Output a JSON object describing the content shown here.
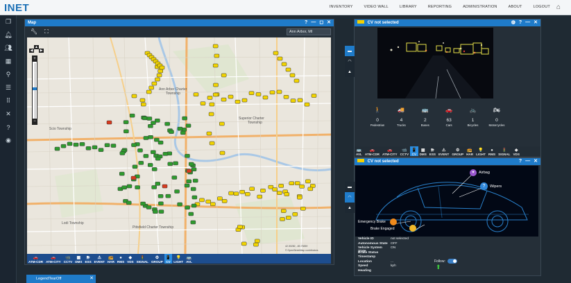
{
  "app": {
    "logo": "INET"
  },
  "topnav": [
    "INVENTORY",
    "VIDEO WALL",
    "LIBRARY",
    "REPORTING",
    "ADMINISTRATION",
    "ABOUT",
    "LOGOUT"
  ],
  "sidebar_icons": [
    "copy-icon",
    "bell-icon",
    "users-icon",
    "grid-icon",
    "filter-icon",
    "list-icon",
    "apps-icon",
    "tools-icon",
    "help-icon",
    "user-icon"
  ],
  "map_panel": {
    "title": "Map",
    "location_select": "Ann Arbor, MI",
    "labels": {
      "ann_arbor_charter": "Ann Arbor Charter\nTownship",
      "superior_charter": "Superior Charter\nTownship",
      "scio": "Scio Township",
      "pittsfield": "Pittsfield Charter Township",
      "lodi": "Lodi Township",
      "coords": "42.30282, -83.73839",
      "attribution": "© OpenStreetMap contributors"
    },
    "toolbar": [
      {
        "label": "ATM-CDR",
        "icon": "🚗"
      },
      {
        "label": "ATM-CITY",
        "icon": "🚗"
      },
      {
        "label": "CCTV",
        "icon": "📹"
      },
      {
        "label": "DMS",
        "icon": "▦"
      },
      {
        "label": "ESS",
        "icon": "⛈"
      },
      {
        "label": "EVENT",
        "icon": "⚠"
      },
      {
        "label": "HAR",
        "icon": "📻"
      },
      {
        "label": "RMS",
        "icon": "●"
      },
      {
        "label": "VDS",
        "icon": "◆"
      },
      {
        "label": "SIGNAL",
        "icon": "🚦"
      },
      {
        "label": "GROUP",
        "icon": "⚙"
      },
      {
        "label": "CV",
        "icon": "📱"
      },
      {
        "label": "LIGHT",
        "icon": "💡"
      },
      {
        "label": "AVL",
        "icon": "🚌"
      }
    ],
    "toolbar_active": "CV"
  },
  "video_panel": {
    "title": "CV not selected",
    "counts": [
      {
        "icon": "🚶",
        "value": "0",
        "label": "Pedestrian"
      },
      {
        "icon": "🚚",
        "value": "4",
        "label": "Trucks"
      },
      {
        "icon": "🚌",
        "value": "2",
        "label": "Buses"
      },
      {
        "icon": "🚗",
        "value": "63",
        "label": "Cars"
      },
      {
        "icon": "🚲",
        "value": "1",
        "label": "Bicycles"
      },
      {
        "icon": "🏍",
        "value": "0",
        "label": "Motorcycles"
      }
    ],
    "toolbar": [
      {
        "label": "AVL",
        "icon": "🚌"
      },
      {
        "label": "ATM-CDR",
        "icon": "🚗"
      },
      {
        "label": "ATM-CITY",
        "icon": "🚗"
      },
      {
        "label": "CCTV",
        "icon": "📹"
      },
      {
        "label": "CV",
        "icon": "📱"
      },
      {
        "label": "DMS",
        "icon": "▦"
      },
      {
        "label": "ESS",
        "icon": "⛈"
      },
      {
        "label": "EVENT",
        "icon": "⚠"
      },
      {
        "label": "GROUP",
        "icon": "⚙"
      },
      {
        "label": "HAR",
        "icon": "📻"
      },
      {
        "label": "LIGHT",
        "icon": "💡"
      },
      {
        "label": "RMS",
        "icon": "●"
      },
      {
        "label": "SIGNAL",
        "icon": "🚦"
      },
      {
        "label": "VDS",
        "icon": "◆"
      }
    ],
    "toolbar_active": "CV"
  },
  "vehicle_panel": {
    "title": "CV not selected",
    "callouts": {
      "airbag": "Airbag",
      "wipers": "Wipers",
      "emergency_brake": "Emergency Brake",
      "brake_engaged": "Brake Engaged"
    },
    "fields": [
      {
        "k": "Vehicle ID",
        "v": "not selected"
      },
      {
        "k": "Autonomous State",
        "v": "OFF"
      },
      {
        "k": "Vehicle System State",
        "v": "ON"
      },
      {
        "k": "Brake Status",
        "v": ""
      },
      {
        "k": "Timestamp",
        "v": ""
      },
      {
        "k": "Location",
        "v": "..."
      },
      {
        "k": "Speed",
        "v": "kph"
      },
      {
        "k": "Heading",
        "v": ""
      }
    ],
    "follow_label": "Follow:"
  },
  "legend_tab": {
    "label": "LegendTearOff"
  },
  "colors": {
    "header_blue": "#1f7bc9",
    "toolbar_blue": "#1d4d8e",
    "marker_yellow": "#f2d400",
    "marker_green": "#2e9a2e",
    "marker_red": "#d83a1e"
  }
}
